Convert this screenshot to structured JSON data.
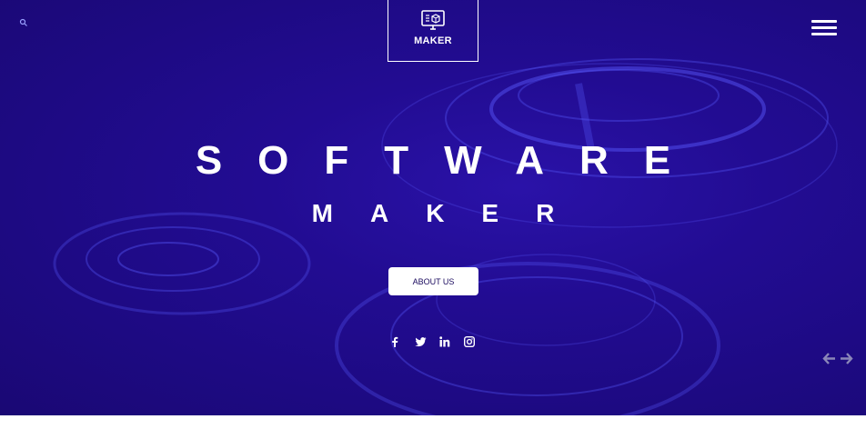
{
  "brand": {
    "name": "MAKER"
  },
  "hero": {
    "title": "SOFTWARE",
    "subtitle": "MAKER",
    "cta_label": "ABOUT US"
  },
  "icons": {
    "search": "search-icon",
    "logo": "monitor-cube-icon",
    "menu": "hamburger-menu-icon",
    "social": [
      "facebook-icon",
      "twitter-icon",
      "linkedin-icon",
      "instagram-icon"
    ],
    "slider": [
      "arrow-left-icon",
      "arrow-right-icon"
    ]
  },
  "colors": {
    "hero_background": "#220c92",
    "text": "#ffffff",
    "button_text": "#1a0a5e",
    "arrow": "#8a86b8"
  }
}
